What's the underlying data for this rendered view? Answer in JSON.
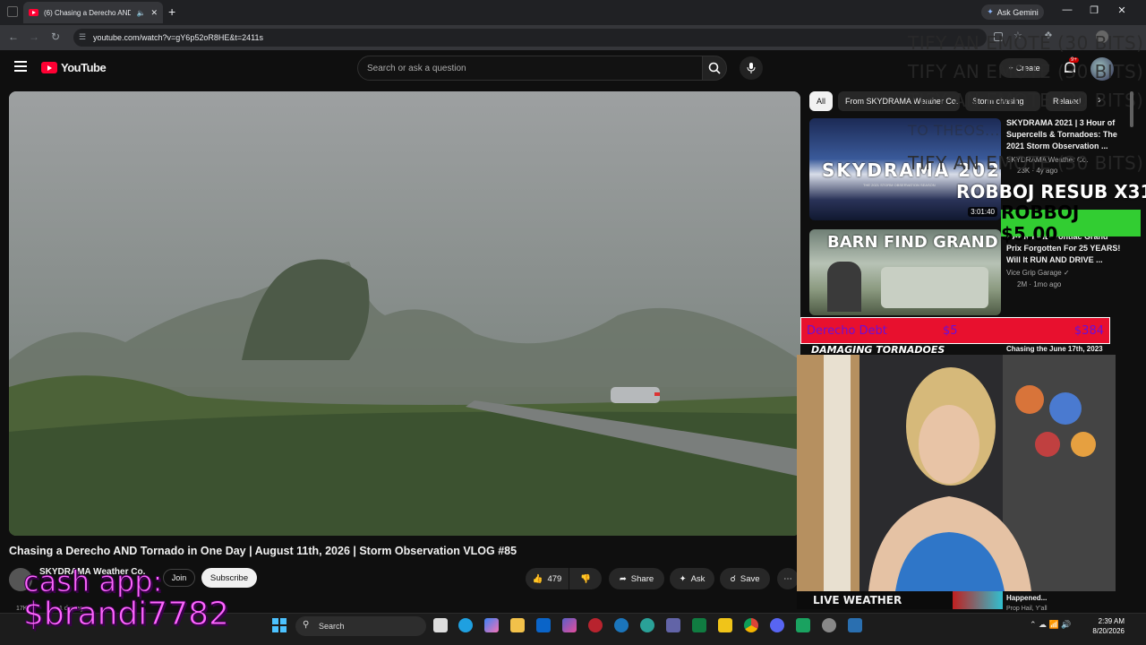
{
  "browser": {
    "tab_title": "(6) Chasing a Derecho AND",
    "url": "youtube.com/watch?v=gY6p52oR8HE&t=2411s",
    "gemini_label": "Ask Gemini"
  },
  "youtube": {
    "logo_text": "YouTube",
    "search_placeholder": "Search or ask a question",
    "create_label": "Create",
    "notification_count": "9+"
  },
  "video": {
    "title": "Chasing a Derecho AND Tornado in One Day | August 11th, 2026 | Storm Observation VLOG #85",
    "channel": "SKYDRAMA Weather Co.",
    "subscribers": "17K",
    "time_ago": "1 day ago",
    "join_label": "Join",
    "subscribe_label": "Subscribe",
    "likes": "479",
    "share_label": "Share",
    "ask_label": "Ask",
    "save_label": "Save"
  },
  "sidebar": {
    "chips": [
      "All",
      "From SKYDRAMA Weather Co.",
      "Storm chasing",
      "Related"
    ],
    "recs": [
      {
        "title_line1": "SKYDRAMA 2021 | 3 Hour of",
        "title_line2": "Supercells & Tornadoes: The",
        "title_line3": "2021 Storm Observation ...",
        "channel": "SKYDRAMA Weather Co.",
        "meta": "23K · 4y ago",
        "duration": "3:01:40",
        "thumb_text": "SKYDRAMA 2021",
        "thumb_sub": "THE 2021 STORM OBSERVATION SEASON"
      },
      {
        "title_line1": "BARN FIND Pontiac Grand",
        "title_line2": "Prix Forgotten For 25 YEARS!",
        "title_line3": "Will It RUN AND DRIVE ...",
        "channel": "Vice Grip Garage",
        "meta": "2M · 1mo ago",
        "thumb_text": "BARN FIND GRAND PRIX"
      },
      {
        "thumb_text": "DAMAGING TORNADOES",
        "title_line1": "Chasing the June 17th, 2023"
      },
      {
        "thumb_text": "LIVE WEATHER",
        "title_line1": "Happened...",
        "channel": "Prop Hail, Y'all"
      }
    ]
  },
  "overlay": {
    "emote_lines": [
      "TIFY AN EMOTE (30 BITS)",
      "TIFY AN EMOTE (30 BITS)",
      "TIFY AN EMOTE (30 BITS)",
      "TIFY AN EMOTE (30 BITS)",
      "TO THEOS..."
    ],
    "resub": "ROBBOJ  RESUB X31",
    "tip": "ROBBOJ  $5.00",
    "goal_name": "Derecho Debt",
    "goal_current": "$5",
    "goal_target": "$384",
    "cash_line1": "cash app:",
    "cash_line2": "$brandi7782"
  },
  "taskbar": {
    "search_label": "Search",
    "time": "2:39 AM",
    "date": "8/20/2026"
  },
  "colors": {
    "brand_red": "#ff0033",
    "tip_green": "#32cd32",
    "goal_red": "#e8102e",
    "cash_pink": "#ff66ff"
  }
}
